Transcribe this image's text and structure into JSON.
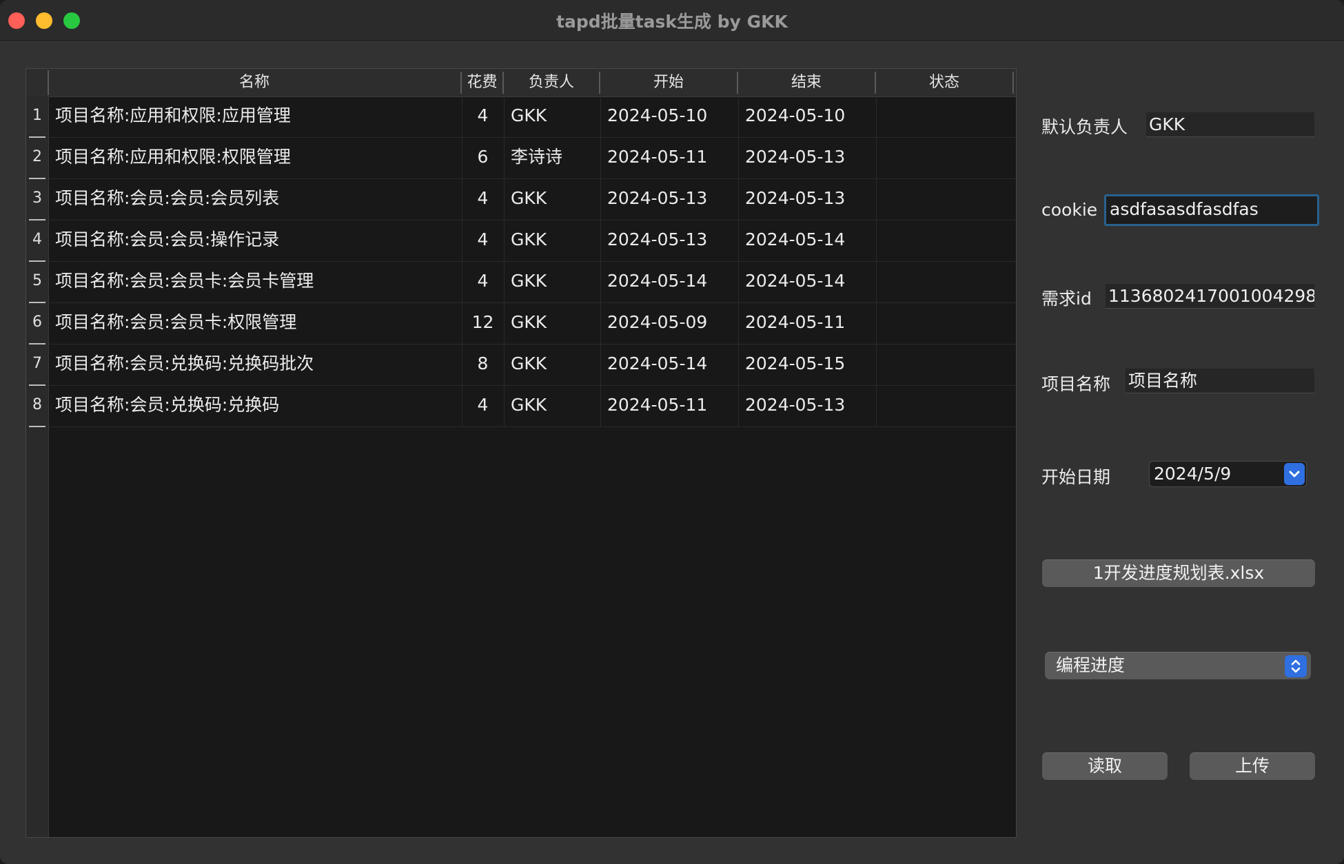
{
  "window": {
    "title": "tapd批量task生成 by GKK"
  },
  "table": {
    "columns": [
      "名称",
      "花费",
      "负责人",
      "开始",
      "结束",
      "状态"
    ],
    "rows": [
      {
        "num": "1",
        "name": "项目名称:应用和权限:应用管理",
        "cost": "4",
        "owner": "GKK",
        "start": "2024-05-10",
        "end": "2024-05-10",
        "status": ""
      },
      {
        "num": "2",
        "name": "项目名称:应用和权限:权限管理",
        "cost": "6",
        "owner": "李诗诗",
        "start": "2024-05-11",
        "end": "2024-05-13",
        "status": ""
      },
      {
        "num": "3",
        "name": "项目名称:会员:会员:会员列表",
        "cost": "4",
        "owner": "GKK",
        "start": "2024-05-13",
        "end": "2024-05-13",
        "status": ""
      },
      {
        "num": "4",
        "name": "项目名称:会员:会员:操作记录",
        "cost": "4",
        "owner": "GKK",
        "start": "2024-05-13",
        "end": "2024-05-14",
        "status": ""
      },
      {
        "num": "5",
        "name": "项目名称:会员:会员卡:会员卡管理",
        "cost": "4",
        "owner": "GKK",
        "start": "2024-05-14",
        "end": "2024-05-14",
        "status": ""
      },
      {
        "num": "6",
        "name": "项目名称:会员:会员卡:权限管理",
        "cost": "12",
        "owner": "GKK",
        "start": "2024-05-09",
        "end": "2024-05-11",
        "status": ""
      },
      {
        "num": "7",
        "name": "项目名称:会员:兑换码:兑换码批次",
        "cost": "8",
        "owner": "GKK",
        "start": "2024-05-14",
        "end": "2024-05-15",
        "status": ""
      },
      {
        "num": "8",
        "name": "项目名称:会员:兑换码:兑换码",
        "cost": "4",
        "owner": "GKK",
        "start": "2024-05-11",
        "end": "2024-05-13",
        "status": ""
      }
    ]
  },
  "panel": {
    "default_owner_label": "默认负责人",
    "default_owner_value": "GKK",
    "cookie_label": "cookie",
    "cookie_value": "asdfasasdfasdfas",
    "req_id_label": "需求id",
    "req_id_value": "1136802417001004298",
    "project_label": "项目名称",
    "project_value": "项目名称",
    "start_date_label": "开始日期",
    "start_date_value": "2024/5/9",
    "file_button_label": "1开发进度规划表.xlsx",
    "sheet_select_value": "编程进度",
    "read_button_label": "读取",
    "upload_button_label": "上传"
  },
  "colors": {
    "accent": "#2f6fe0",
    "focus_ring": "#27618f",
    "close": "#fe5f57",
    "minimize": "#febc2e",
    "maximize": "#28c840"
  },
  "icons": {
    "date_dropdown": "chevron-down-icon",
    "select_stepper": "up-down-chevron-icon"
  }
}
